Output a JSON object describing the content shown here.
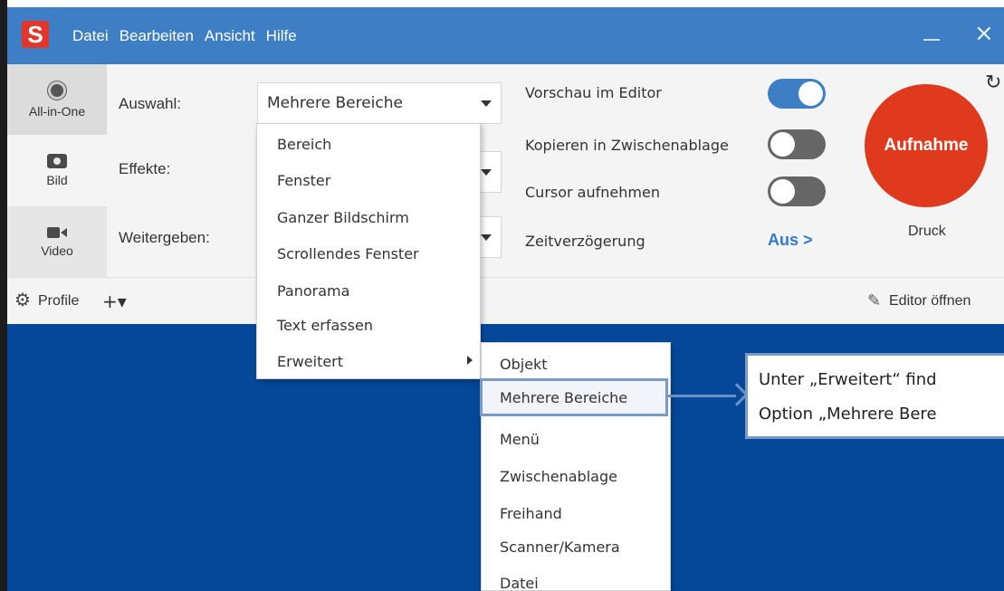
{
  "app": {
    "logo_letter": "S",
    "menu": [
      "Datei",
      "Bearbeiten",
      "Ansicht",
      "Hilfe"
    ],
    "close_symbol": "×"
  },
  "modes": [
    {
      "label": "All-in-One",
      "icon": "record-icon"
    },
    {
      "label": "Bild",
      "icon": "camera-icon"
    },
    {
      "label": "Video",
      "icon": "video-camera-icon"
    }
  ],
  "fields": {
    "selection_label": "Auswahl:",
    "selection_value": "Mehrere Bereiche",
    "effects_label": "Effekte:",
    "share_label": "Weitergeben:"
  },
  "options": [
    {
      "label": "Vorschau im Editor",
      "state": "on"
    },
    {
      "label": "Kopieren in Zwischenablage",
      "state": "off"
    },
    {
      "label": "Cursor aufnehmen",
      "state": "off"
    },
    {
      "label": "Zeitverzögerung",
      "value": "Aus >"
    }
  ],
  "capture": {
    "button_label": "Aufnahme",
    "hotkey": "Druck",
    "accent_color": "#e03a1e"
  },
  "bottom": {
    "profile_label": "Profile",
    "add_symbol": "+▾",
    "editor_label": "Editor öffnen"
  },
  "dropdown_menu": [
    "Bereich",
    "Fenster",
    "Ganzer Bildschirm",
    "Scrollendes Fenster",
    "Panorama",
    "Text erfassen",
    "Erweitert"
  ],
  "submenu": [
    "Objekt",
    "Mehrere Bereiche",
    "Menü",
    "Zwischenablage",
    "Freihand",
    "Scanner/Kamera",
    "Datei"
  ],
  "callout": {
    "line1": "Unter „Erweitert“ find",
    "line2": "Option „Mehrere Bere"
  },
  "colors": {
    "titlebar": "#3d7ec4",
    "desktop": "#05489a",
    "toggle_on": "#3d7ec4",
    "highlight_border": "#7a99c6"
  }
}
